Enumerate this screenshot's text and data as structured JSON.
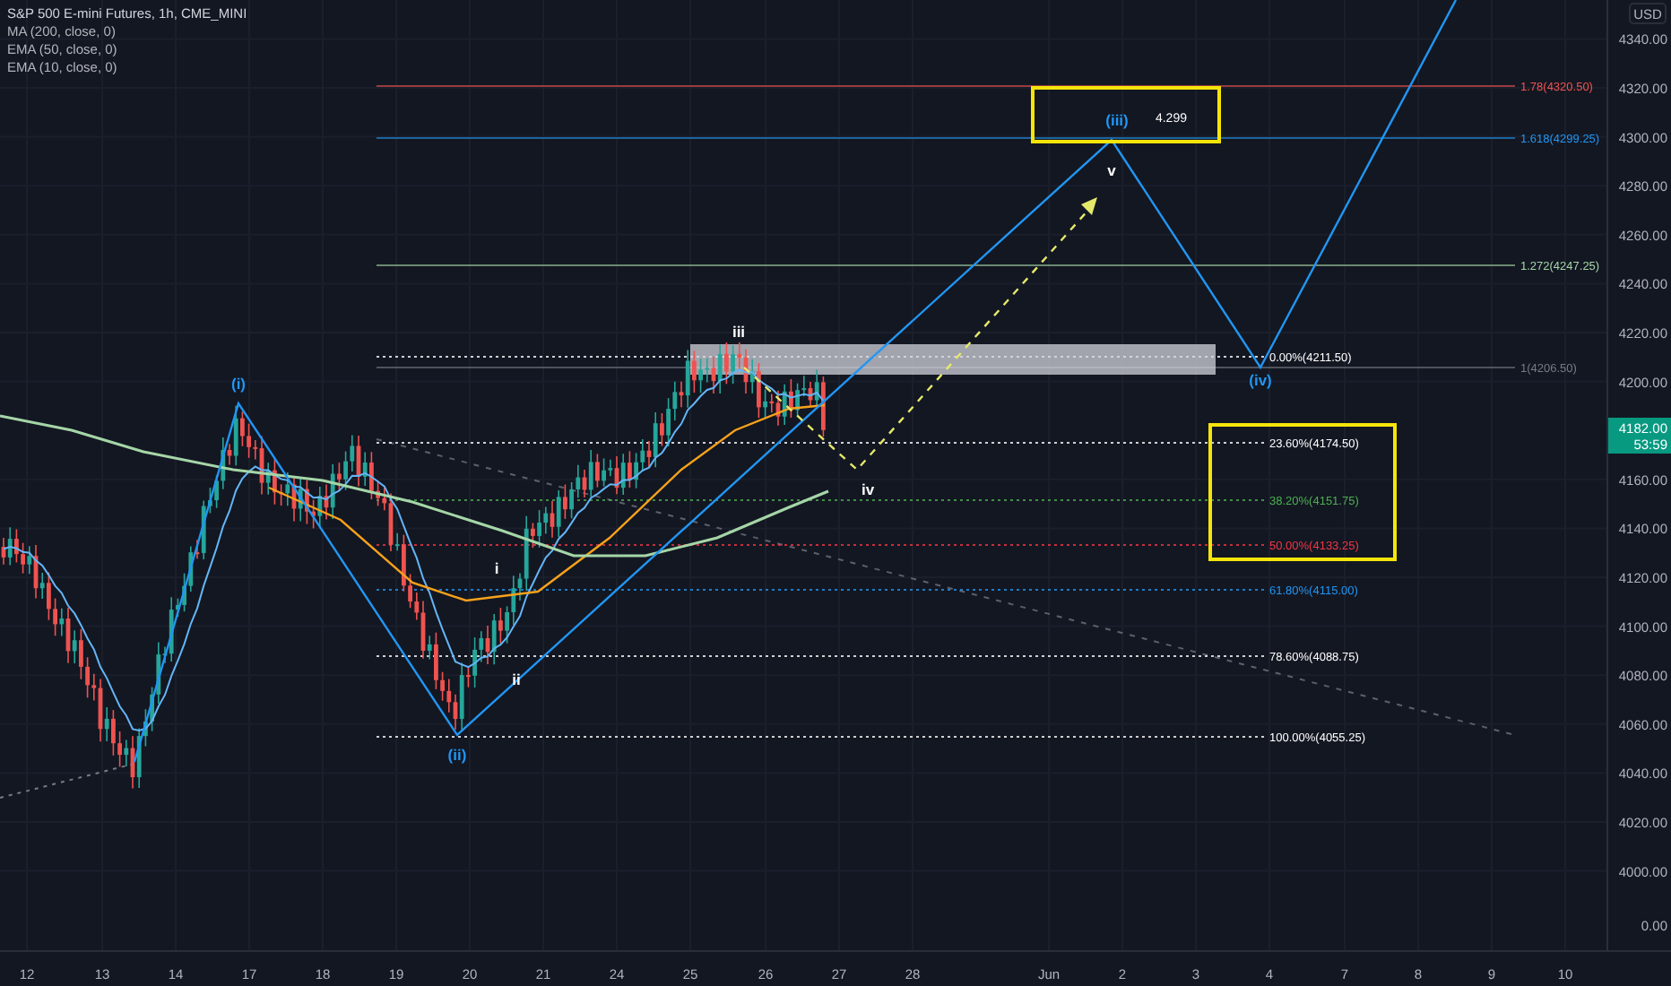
{
  "legend": {
    "symbol": "S&P 500 E-mini Futures, 1h, CME_MINI",
    "indicators": [
      "MA (200, close, 0)",
      "EMA (50, close, 0)",
      "EMA (10, close, 0)"
    ]
  },
  "price_axis": {
    "currency": "USD",
    "ticks": [
      "4340.00",
      "4320.00",
      "4300.00",
      "4280.00",
      "4260.00",
      "4240.00",
      "4220.00",
      "4200.00",
      "4160.00",
      "4140.00",
      "4120.00",
      "4100.00",
      "4080.00",
      "4060.00",
      "4040.00",
      "4020.00",
      "4000.00"
    ],
    "zero": "0.00",
    "last_price": "4182.00",
    "countdown": "53:59"
  },
  "time_axis": {
    "ticks": [
      "12",
      "13",
      "14",
      "17",
      "18",
      "19",
      "20",
      "21",
      "24",
      "25",
      "26",
      "27",
      "28",
      "Jun",
      "2",
      "3",
      "4",
      "7",
      "8",
      "9",
      "10"
    ]
  },
  "fib_levels": [
    {
      "label": "1.78(4320.50)",
      "kind": "extension",
      "color": "#ef5350"
    },
    {
      "label": "1.618(4299.25)",
      "kind": "extension",
      "color": "#2196f3"
    },
    {
      "label": "1.272(4247.25)",
      "kind": "extension",
      "color": "#a5d6a7"
    },
    {
      "label": "0.00%(4211.50)",
      "kind": "retracement",
      "color": "#ffffff"
    },
    {
      "label": "1(4206.50)",
      "kind": "extension",
      "color": "#787b86"
    },
    {
      "label": "23.60%(4174.50)",
      "kind": "retracement",
      "color": "#ffffff"
    },
    {
      "label": "38.20%(4151.75)",
      "kind": "retracement",
      "color": "#4caf50"
    },
    {
      "label": "50.00%(4133.25)",
      "kind": "retracement",
      "color": "#f23645"
    },
    {
      "label": "61.80%(4115.00)",
      "kind": "retracement",
      "color": "#2196f3"
    },
    {
      "label": "78.60%(4088.75)",
      "kind": "retracement",
      "color": "#ffffff"
    },
    {
      "label": "100.00%(4055.25)",
      "kind": "retracement",
      "color": "#ffffff"
    }
  ],
  "wave_labels": [
    {
      "text": "(i)",
      "color": "#2196f3"
    },
    {
      "text": "(ii)",
      "color": "#2196f3"
    },
    {
      "text": "i",
      "color": "#ffffff"
    },
    {
      "text": "ii",
      "color": "#ffffff"
    },
    {
      "text": "iii",
      "color": "#ffffff"
    },
    {
      "text": "iv",
      "color": "#ffffff"
    },
    {
      "text": "v",
      "color": "#ffffff"
    },
    {
      "text": "(iii)",
      "color": "#2196f3"
    },
    {
      "text": "(iv)",
      "color": "#2196f3"
    }
  ],
  "target_box": {
    "value": "4.299"
  }
}
